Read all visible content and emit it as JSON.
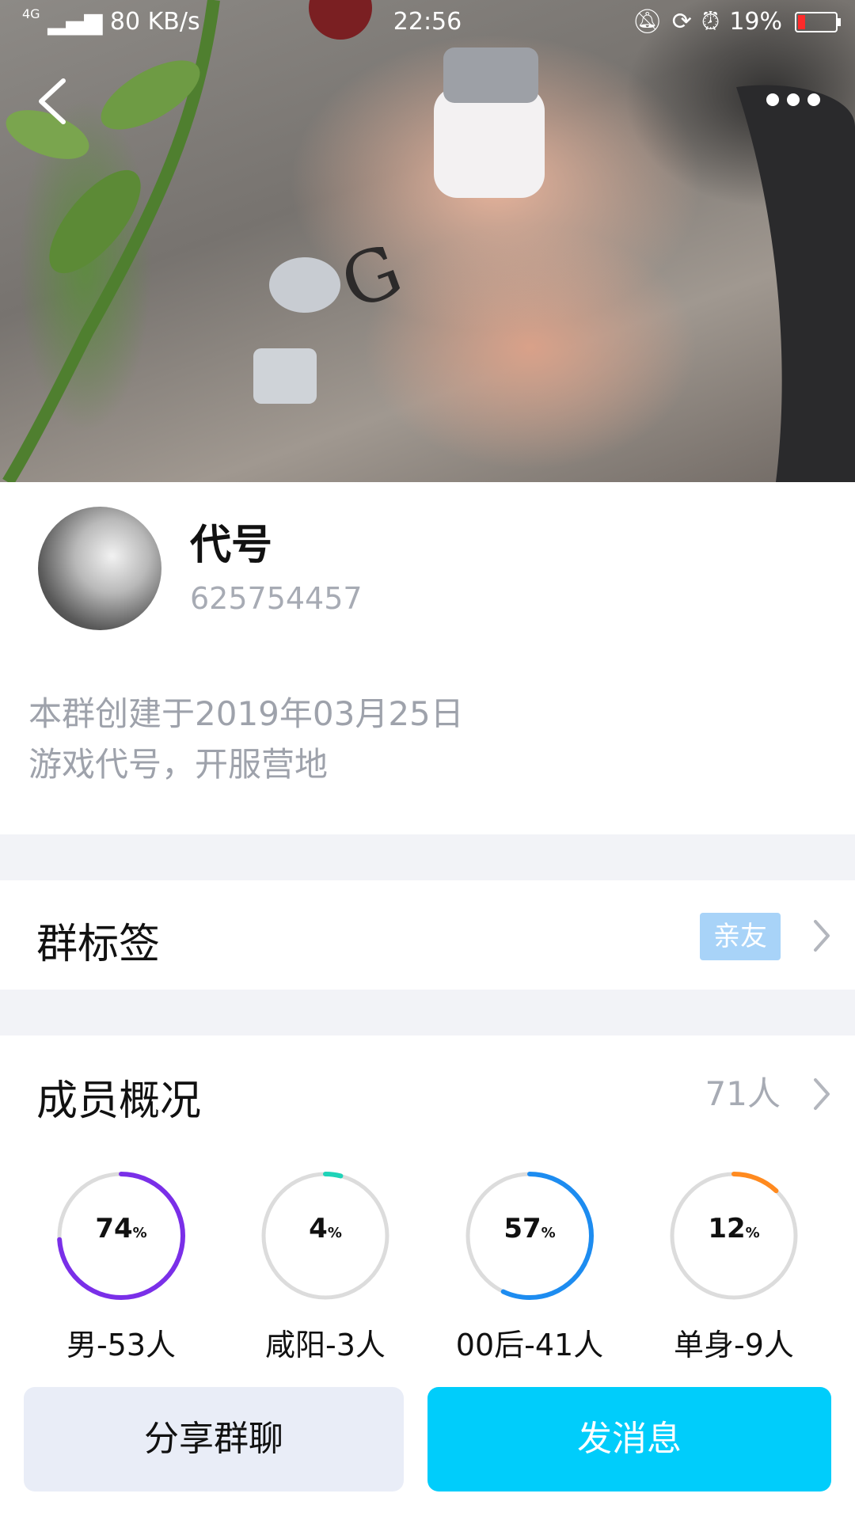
{
  "status_bar": {
    "network": "4G",
    "speed": "80 KB/s",
    "time": "22:56",
    "battery": "19%",
    "battery_color": "#ff2a2a",
    "icons": [
      "mute-icon",
      "lock-rotation-icon",
      "alarm-icon",
      "battery-icon"
    ]
  },
  "header": {
    "back_icon": "chevron-left-icon",
    "more_icon": "more-dots-icon"
  },
  "group": {
    "name": "代号",
    "id": "625754457",
    "created": "本群创建于2019年03月25日",
    "intro": "游戏代号，开服营地"
  },
  "tags_row": {
    "title": "群标签",
    "tag": "亲友"
  },
  "members_row": {
    "title": "成员概况",
    "count": "71人"
  },
  "stats": [
    {
      "percent": "74",
      "unit": "%",
      "label": "男-53人",
      "fraction": 0.74,
      "color": "#7a2fe8"
    },
    {
      "percent": "4",
      "unit": "%",
      "label": "咸阳-3人",
      "fraction": 0.04,
      "color": "#1fd3b8"
    },
    {
      "percent": "57",
      "unit": "%",
      "label": "00后-41人",
      "fraction": 0.57,
      "color": "#1d8cf0"
    },
    {
      "percent": "12",
      "unit": "%",
      "label": "单身-9人",
      "fraction": 0.12,
      "color": "#ff8a1f"
    }
  ],
  "buttons": {
    "share": "分享群聊",
    "send": "发消息"
  }
}
